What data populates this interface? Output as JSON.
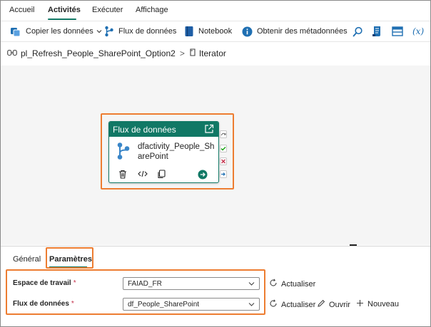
{
  "tabs": [
    {
      "label": "Accueil",
      "active": false
    },
    {
      "label": "Activités",
      "active": true
    },
    {
      "label": "Exécuter",
      "active": false
    },
    {
      "label": "Affichage",
      "active": false
    }
  ],
  "toolbar": {
    "copy_data": "Copier les données",
    "dataflow": "Flux de données",
    "notebook": "Notebook",
    "metadata": "Obtenir des métadonnées",
    "icons": [
      "copy-data-icon",
      "dataflow-icon",
      "notebook-icon",
      "info-icon",
      "search-icon",
      "script-icon",
      "table-icon",
      "expression-icon"
    ],
    "expression_label": "(x)"
  },
  "breadcrumb": {
    "pipeline": "pl_Refresh_People_SharePoint_Option2",
    "separator": ">",
    "current": "Iterator"
  },
  "activity": {
    "type_title": "Flux de données",
    "name": "dfactivity_People_SharePoint",
    "accent": "#117865"
  },
  "bottom_tabs": [
    {
      "label": "Général",
      "active": false
    },
    {
      "label": "Paramètres",
      "active": true
    }
  ],
  "settings": {
    "workspace": {
      "label": "Espace de travail",
      "required": "*",
      "value": "FAIAD_FR",
      "refresh": "Actualiser"
    },
    "dataflow": {
      "label": "Flux de données",
      "required": "*",
      "value": "df_People_SharePoint",
      "refresh": "Actualiser",
      "open": "Ouvrir",
      "new": "Nouveau"
    }
  },
  "colors": {
    "highlight": "#ed7d31",
    "brand": "#117865",
    "required": "#c4314b"
  }
}
